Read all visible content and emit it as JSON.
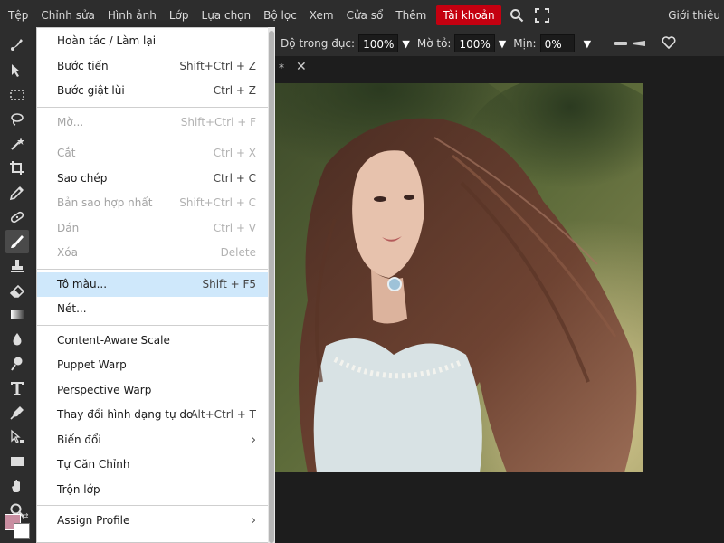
{
  "menubar": {
    "items": [
      "Tệp",
      "Chỉnh sửa",
      "Hình ảnh",
      "Lớp",
      "Lựa chọn",
      "Bộ lọc",
      "Xem",
      "Cửa sổ",
      "Thêm"
    ],
    "account": "Tài khoản",
    "intro": "Giới thiệu",
    "icons": [
      "search-icon",
      "fullscreen-icon"
    ]
  },
  "options": {
    "opacity_label": "Độ trong đục:",
    "opacity_value": "100%",
    "flow_label": "Mờ tỏ:",
    "flow_value": "100%",
    "smooth_label": "Mịn:",
    "smooth_value": "0%"
  },
  "tab": {
    "star": "*",
    "close": "✕"
  },
  "edit_menu": {
    "items": [
      {
        "label": "Hoàn tác / Làm lại",
        "shortcut": "",
        "state": "normal"
      },
      {
        "label": "Bước tiến",
        "shortcut": "Shift+Ctrl + Z",
        "state": "normal"
      },
      {
        "label": "Bước giật lùi",
        "shortcut": "Ctrl + Z",
        "state": "normal"
      },
      {
        "label": "Mờ...",
        "shortcut": "Shift+Ctrl + F",
        "state": "disabled"
      },
      {
        "label": "Cắt",
        "shortcut": "Ctrl + X",
        "state": "disabled"
      },
      {
        "label": "Sao chép",
        "shortcut": "Ctrl + C",
        "state": "normal"
      },
      {
        "label": "Bản sao hợp nhất",
        "shortcut": "Shift+Ctrl + C",
        "state": "disabled"
      },
      {
        "label": "Dán",
        "shortcut": "Ctrl + V",
        "state": "disabled"
      },
      {
        "label": "Xóa",
        "shortcut": "Delete",
        "state": "disabled"
      },
      {
        "label": "Tô màu...",
        "shortcut": "Shift + F5",
        "state": "highlight"
      },
      {
        "label": "Nét...",
        "shortcut": "",
        "state": "normal"
      },
      {
        "label": "Content-Aware Scale",
        "shortcut": "",
        "state": "normal"
      },
      {
        "label": "Puppet Warp",
        "shortcut": "",
        "state": "normal"
      },
      {
        "label": "Perspective Warp",
        "shortcut": "",
        "state": "normal"
      },
      {
        "label": "Thay đổi hình dạng tự do",
        "shortcut": "Alt+Ctrl + T",
        "state": "normal"
      },
      {
        "label": "Biến đổi",
        "shortcut": "",
        "state": "submenu"
      },
      {
        "label": "Tự Căn Chỉnh",
        "shortcut": "",
        "state": "normal"
      },
      {
        "label": "Trộn lớp",
        "shortcut": "",
        "state": "normal"
      },
      {
        "label": "Assign Profile",
        "shortcut": "",
        "state": "submenu"
      }
    ],
    "submenu_arrow": "›"
  },
  "colors": {
    "foreground": "#c98ea1",
    "background": "#ffffff",
    "account_bg": "#c40010",
    "highlight": "#cfe8fb"
  },
  "tools": [
    "move-tool-icon",
    "marquee-tool-icon",
    "lasso-tool-icon",
    "magic-wand-tool-icon",
    "crop-tool-icon",
    "eyedropper-tool-icon",
    "healing-tool-icon",
    "brush-tool-icon",
    "stamp-tool-icon",
    "eraser-tool-icon",
    "gradient-tool-icon",
    "blur-tool-icon",
    "dodge-tool-icon",
    "type-tool-icon",
    "pen-tool-icon",
    "path-select-tool-icon",
    "shape-tool-icon",
    "hand-tool-icon",
    "zoom-tool-icon"
  ]
}
